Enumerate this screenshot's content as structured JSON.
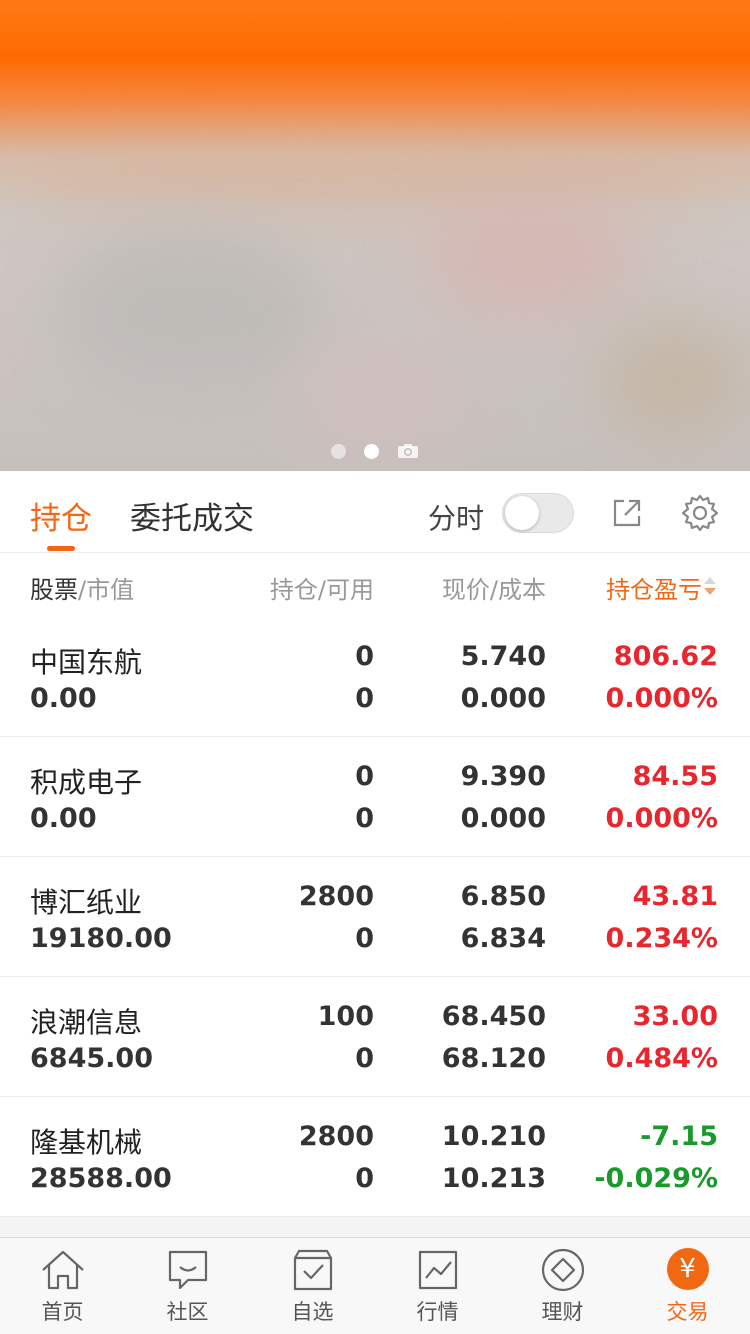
{
  "banner": {
    "page_count": 2,
    "active_page": 2
  },
  "tabs": {
    "holdings": "持仓",
    "orders": "委托成交",
    "timeshare_label": "分时",
    "timeshare_on": false
  },
  "header": {
    "stock": "股票",
    "market_value": "/市值",
    "holding": "持仓/可用",
    "price": "现价/成本",
    "pl": "持仓盈亏"
  },
  "rows": [
    {
      "name": "中国东航",
      "market_value": "0.00",
      "holding": "0",
      "available": "0",
      "price": "5.740",
      "cost": "0.000",
      "pl": "806.62",
      "pl_pct": "0.000%",
      "trend": "up"
    },
    {
      "name": "积成电子",
      "market_value": "0.00",
      "holding": "0",
      "available": "0",
      "price": "9.390",
      "cost": "0.000",
      "pl": "84.55",
      "pl_pct": "0.000%",
      "trend": "up"
    },
    {
      "name": "博汇纸业",
      "market_value": "19180.00",
      "holding": "2800",
      "available": "0",
      "price": "6.850",
      "cost": "6.834",
      "pl": "43.81",
      "pl_pct": "0.234%",
      "trend": "up"
    },
    {
      "name": "浪潮信息",
      "market_value": "6845.00",
      "holding": "100",
      "available": "0",
      "price": "68.450",
      "cost": "68.120",
      "pl": "33.00",
      "pl_pct": "0.484%",
      "trend": "up"
    },
    {
      "name": "隆基机械",
      "market_value": "28588.00",
      "holding": "2800",
      "available": "0",
      "price": "10.210",
      "cost": "10.213",
      "pl": "-7.15",
      "pl_pct": "-0.029%",
      "trend": "down"
    }
  ],
  "nav": [
    {
      "label": "首页",
      "icon": "home-icon"
    },
    {
      "label": "社区",
      "icon": "chat-icon"
    },
    {
      "label": "自选",
      "icon": "watchlist-icon"
    },
    {
      "label": "行情",
      "icon": "chart-icon"
    },
    {
      "label": "理财",
      "icon": "diamond-icon"
    },
    {
      "label": "交易",
      "icon": "yen-icon",
      "active": true,
      "glyph": "¥"
    }
  ],
  "colors": {
    "accent": "#f26711",
    "up": "#e8262d",
    "down": "#1a9a2c"
  }
}
